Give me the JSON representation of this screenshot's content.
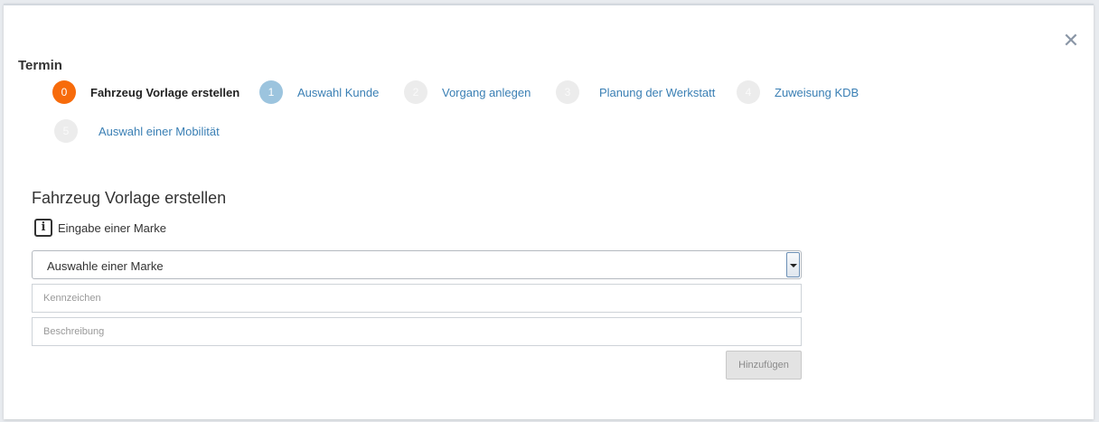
{
  "dialog": {
    "title": "Termin",
    "close_icon": "close-icon"
  },
  "steps": [
    {
      "number": "0",
      "label": "Fahrzeug Vorlage erstellen",
      "state": "active"
    },
    {
      "number": "1",
      "label": "Auswahl Kunde",
      "state": "next"
    },
    {
      "number": "2",
      "label": "Vorgang anlegen",
      "state": "future"
    },
    {
      "number": "3",
      "label": "Planung der Werkstatt",
      "state": "future"
    },
    {
      "number": "4",
      "label": "Zuweisung KDB",
      "state": "future"
    },
    {
      "number": "5",
      "label": "Auswahl einer Mobilität",
      "state": "future"
    }
  ],
  "form": {
    "section_title": "Fahrzeug Vorlage erstellen",
    "info_icon": "info-icon",
    "info_text": "Eingabe einer Marke",
    "brand_select": {
      "value": "Auswahle einer Marke"
    },
    "license_plate": {
      "value": "",
      "placeholder": "Kennzeichen"
    },
    "description": {
      "value": "",
      "placeholder": "Beschreibung"
    },
    "add_button_label": "Hinzufügen"
  },
  "colors": {
    "active_step": "#f76b0b",
    "next_step": "#9cc4de",
    "future_step": "#ececec",
    "link": "#3a7fb4"
  }
}
